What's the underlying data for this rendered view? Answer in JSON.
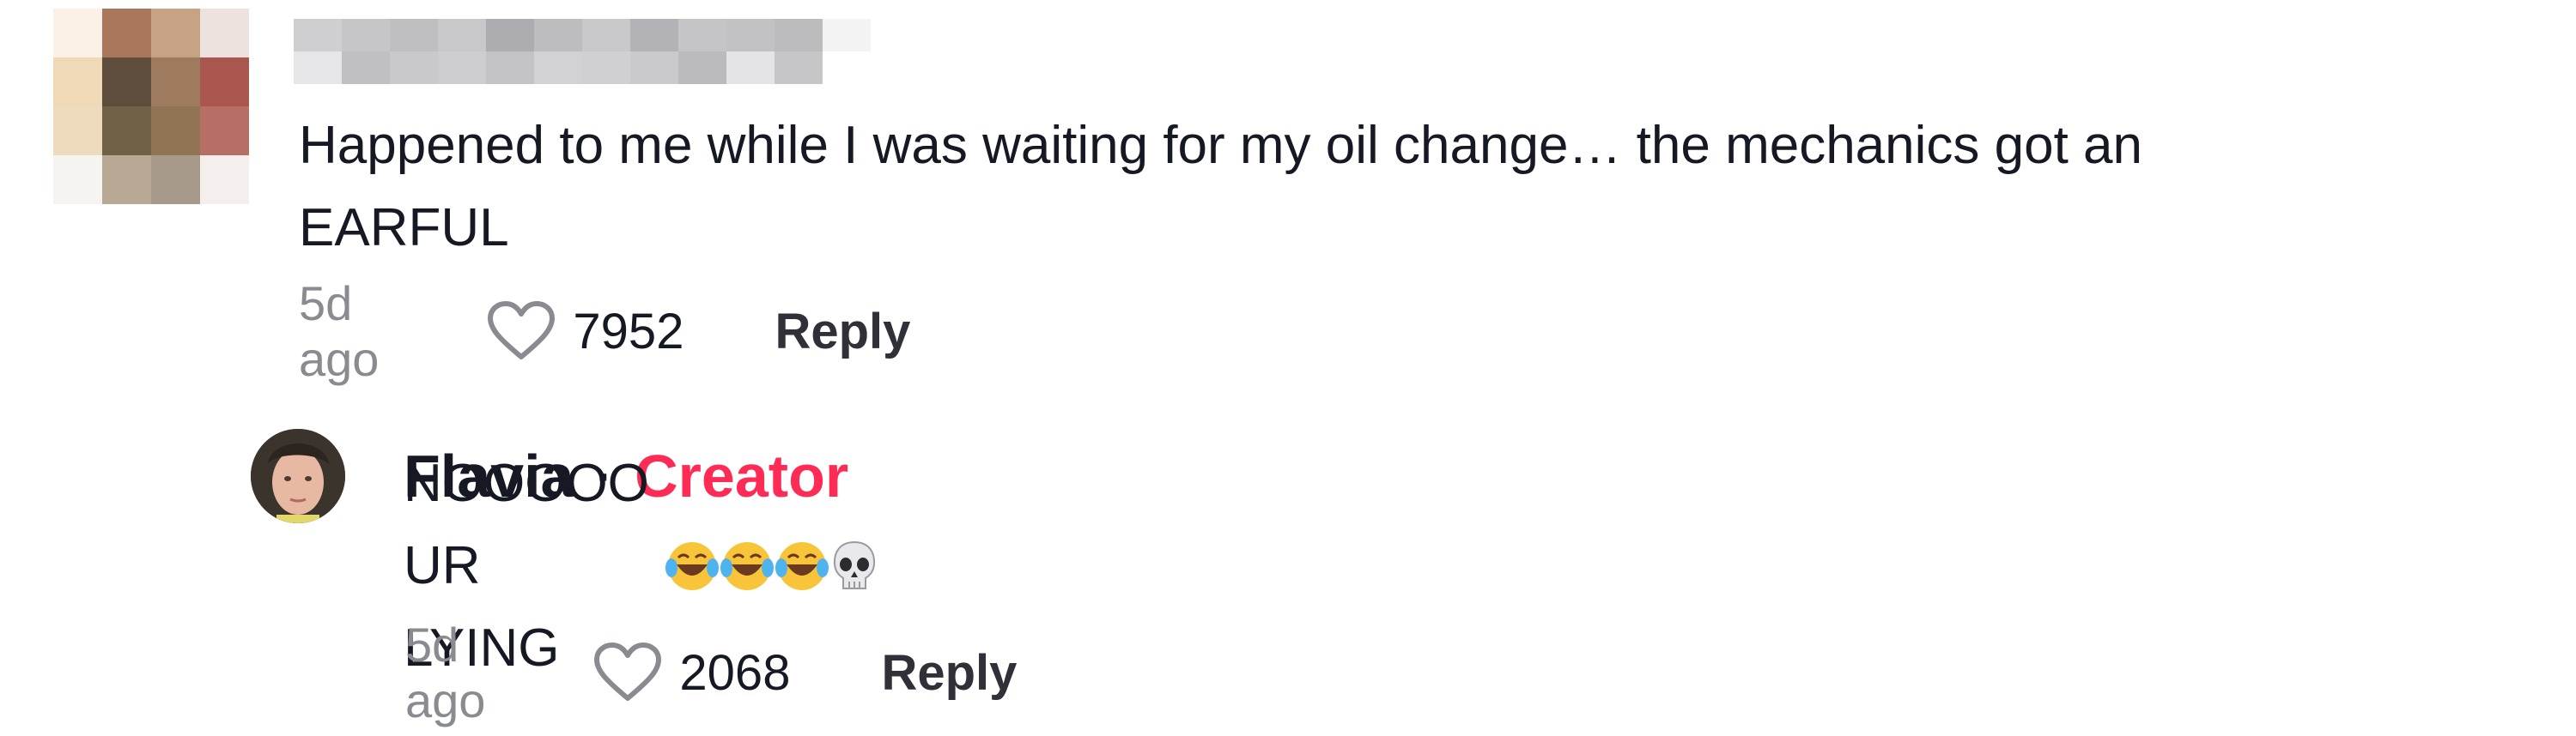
{
  "comments": [
    {
      "text": "Happened to me while I was waiting for my oil change… the mechanics got an\nEARFUL",
      "time": "5d ago",
      "likes": "7952",
      "reply_label": "Reply"
    }
  ],
  "reply": {
    "author": "Flavia",
    "separator": "·",
    "badge": "Creator",
    "text": "NOOOOO UR LYING",
    "time": "5d ago",
    "likes": "2068",
    "reply_label": "Reply"
  },
  "colors": {
    "creator_badge": "#fe2c55",
    "timestamp": "#8a8b91",
    "text": "#161823"
  },
  "icons": [
    "heart-outline-icon",
    "laughing-tears-emoji",
    "skull-emoji"
  ]
}
